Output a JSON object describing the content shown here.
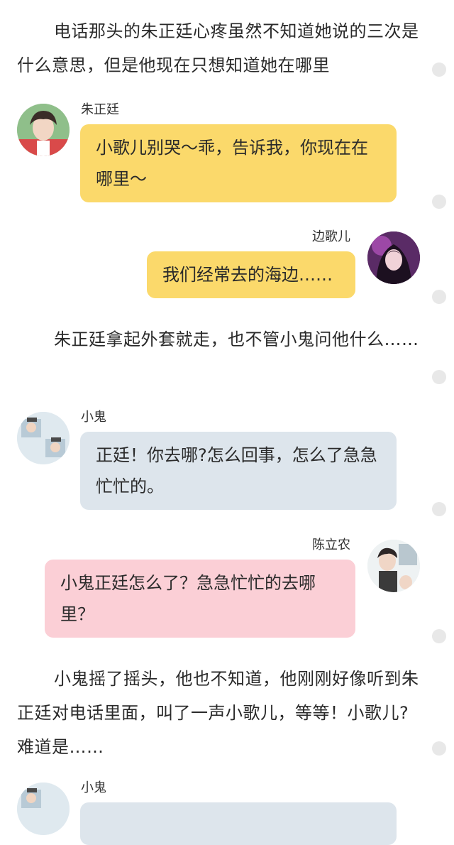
{
  "paragraphs": [
    "电话那头的朱正廷心疼虽然不知道她说的三次是什么意思，但是他现在只想知道她在哪里",
    "朱正廷拿起外套就走，也不管小鬼问他什么……",
    "小鬼摇了摇头，他也不知道，他刚刚好像听到朱正廷对电话里面，叫了一声小歌儿，等等！小歌儿?难道是……"
  ],
  "messages": [
    {
      "name": "朱正廷",
      "text": "小歌儿别哭～乖，告诉我，你现在在哪里～",
      "avatar_icon": "avatar-zhu-icon"
    },
    {
      "name": "边歌儿",
      "text": "我们经常去的海边……",
      "avatar_icon": "avatar-bian-icon"
    },
    {
      "name": "小鬼",
      "text": "正廷！你去哪?怎么回事，怎么了急急忙忙的。",
      "avatar_icon": "avatar-xiaogui-icon"
    },
    {
      "name": "陈立农",
      "text": "小鬼正廷怎么了？急急忙忙的去哪里？",
      "avatar_icon": "avatar-chen-icon"
    },
    {
      "name": "小鬼",
      "text": "",
      "avatar_icon": "avatar-xiaogui-icon"
    }
  ],
  "colors": {
    "yellow_bubble": "#fbd96b",
    "blue_bubble": "#dde5ec",
    "pink_bubble": "#fbcfd6",
    "scroll_dot": "#e8e8e8"
  }
}
